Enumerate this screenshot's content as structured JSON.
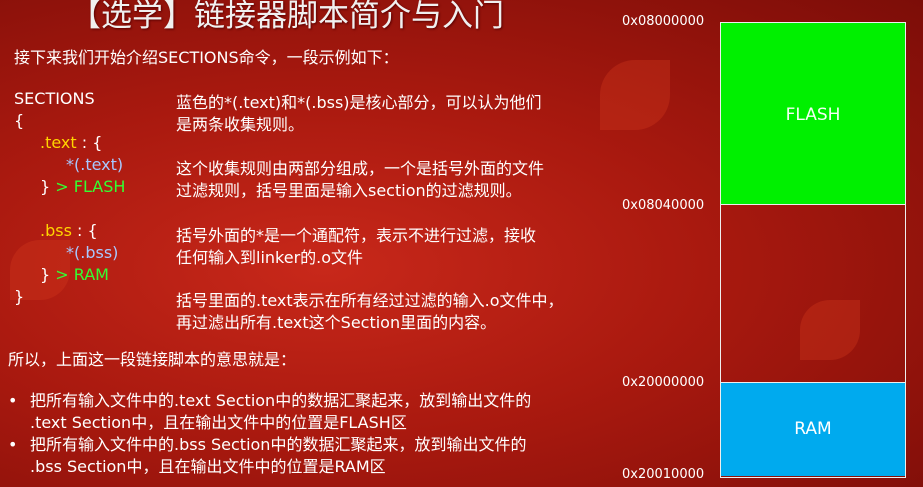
{
  "slide": {
    "title": "【选学】链接器脚本简介与入门",
    "intro": "接下来我们开始介绍SECTIONS命令，一段示例如下：",
    "code": {
      "sections": "SECTIONS",
      "open_brace": "{",
      "text_name": ".text",
      "text_colon": " : {",
      "text_pattern": "*(.text)",
      "text_close": "} ",
      "text_target": "> FLASH",
      "bss_name": ".bss",
      "bss_colon": " : {",
      "bss_pattern": "*(.bss)",
      "bss_close": "} ",
      "bss_target": "> RAM",
      "close_brace": "}"
    },
    "descriptions": [
      [
        "蓝色的*(.text)和*(.bss)是核心部分，可以认为他们",
        "是两条收集规则。"
      ],
      [
        "这个收集规则由两部分组成，一个是括号外面的文件",
        "过滤规则，括号里面是输入section的过滤规则。"
      ],
      [
        "括号外面的*是一个通配符，表示不进行过滤，接收",
        "任何输入到linker的.o文件"
      ],
      [
        "括号里面的.text表示在所有经过过滤的输入.o文件中，",
        "再过滤出所有.text这个Section里面的内容。"
      ]
    ],
    "summary": "所以，上面这一段链接脚本的意思就是：",
    "bullets": [
      [
        "把所有输入文件中的.text Section中的数据汇聚起来，放到输出文件的",
        ".text Section中，且在输出文件中的位置是FLASH区"
      ],
      [
        "把所有输入文件中的.bss Section中的数据汇聚起来，放到输出文件的",
        ".bss Section中，且在输出文件中的位置是RAM区"
      ]
    ],
    "bullet_symbol": "•"
  },
  "memory_map": {
    "addresses": [
      "0x08000000",
      "0x08040000",
      "0x20000000",
      "0x20010000"
    ],
    "flash_label": "FLASH",
    "ram_label": "RAM",
    "colors": {
      "flash": "#00f000",
      "ram": "#00aaee"
    }
  }
}
